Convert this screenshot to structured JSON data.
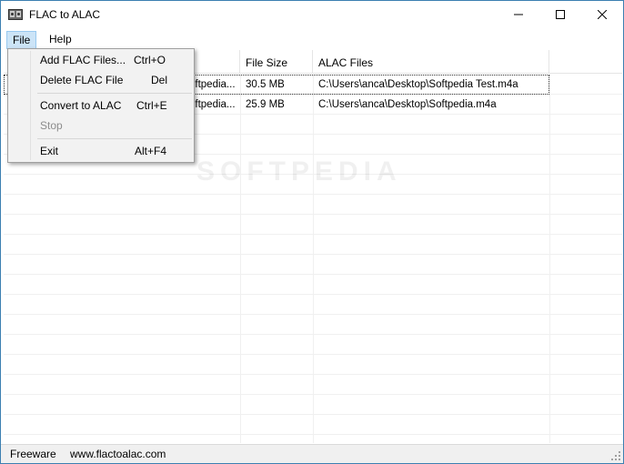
{
  "window": {
    "title": "FLAC to ALAC"
  },
  "menubar": {
    "file": "File",
    "help": "Help"
  },
  "file_menu": {
    "items": [
      {
        "label": "Add FLAC Files...",
        "shortcut": "Ctrl+O",
        "enabled": true
      },
      {
        "label": "Delete FLAC File",
        "shortcut": "Del",
        "enabled": true
      },
      {
        "label": "Convert to ALAC",
        "shortcut": "Ctrl+E",
        "enabled": true
      },
      {
        "label": "Stop",
        "shortcut": "",
        "enabled": false
      },
      {
        "label": "Exit",
        "shortcut": "Alt+F4",
        "enabled": true
      }
    ]
  },
  "list": {
    "columns": [
      "File Size",
      "ALAC Files"
    ],
    "rows": [
      {
        "source": "oftpedia...",
        "size": "30.5 MB",
        "alac": "C:\\Users\\anca\\Desktop\\Softpedia Test.m4a"
      },
      {
        "source": "oftpedia...",
        "size": "25.9 MB",
        "alac": "C:\\Users\\anca\\Desktop\\Softpedia.m4a"
      }
    ]
  },
  "watermark": "SOFTPEDIA",
  "statusbar": {
    "license": "Freeware",
    "website": "www.flactoalac.com"
  }
}
